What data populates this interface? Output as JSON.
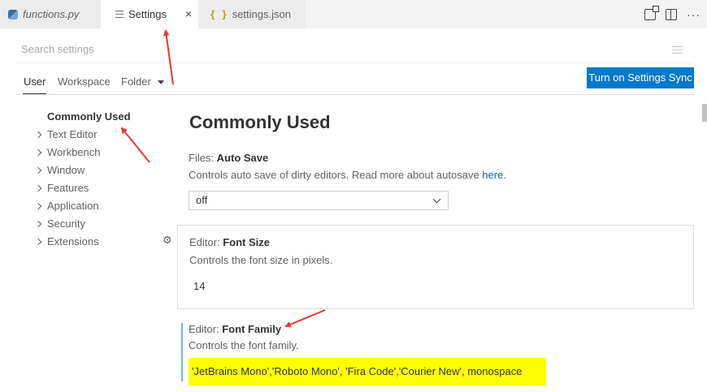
{
  "tabs": {
    "functions": "functions.py",
    "settings": "Settings",
    "json": "settings.json",
    "close_glyph": "×",
    "more_glyph": "···"
  },
  "search": {
    "placeholder": "Search settings"
  },
  "scopes": {
    "user": "User",
    "workspace": "Workspace",
    "folder": "Folder",
    "sync_button": "Turn on Settings Sync"
  },
  "tree": {
    "items": [
      "Commonly Used",
      "Text Editor",
      "Workbench",
      "Window",
      "Features",
      "Application",
      "Security",
      "Extensions"
    ]
  },
  "main": {
    "title": "Commonly Used",
    "auto_save": {
      "category": "Files: ",
      "name": "Auto Save",
      "desc": "Controls auto save of dirty editors. Read more about autosave ",
      "link": "here",
      "desc_end": ".",
      "value": "off"
    },
    "font_size": {
      "category": "Editor: ",
      "name": "Font Size",
      "desc": "Controls the font size in pixels.",
      "value": "14"
    },
    "font_family": {
      "category": "Editor: ",
      "name": "Font Family",
      "desc": "Controls the font family.",
      "value": "'JetBrains Mono','Roboto Mono', 'Fira Code','Courier New', monospace"
    }
  },
  "colors": {
    "accent": "#007acc",
    "highlight": "#ffff00",
    "arrow": "#e53935"
  }
}
